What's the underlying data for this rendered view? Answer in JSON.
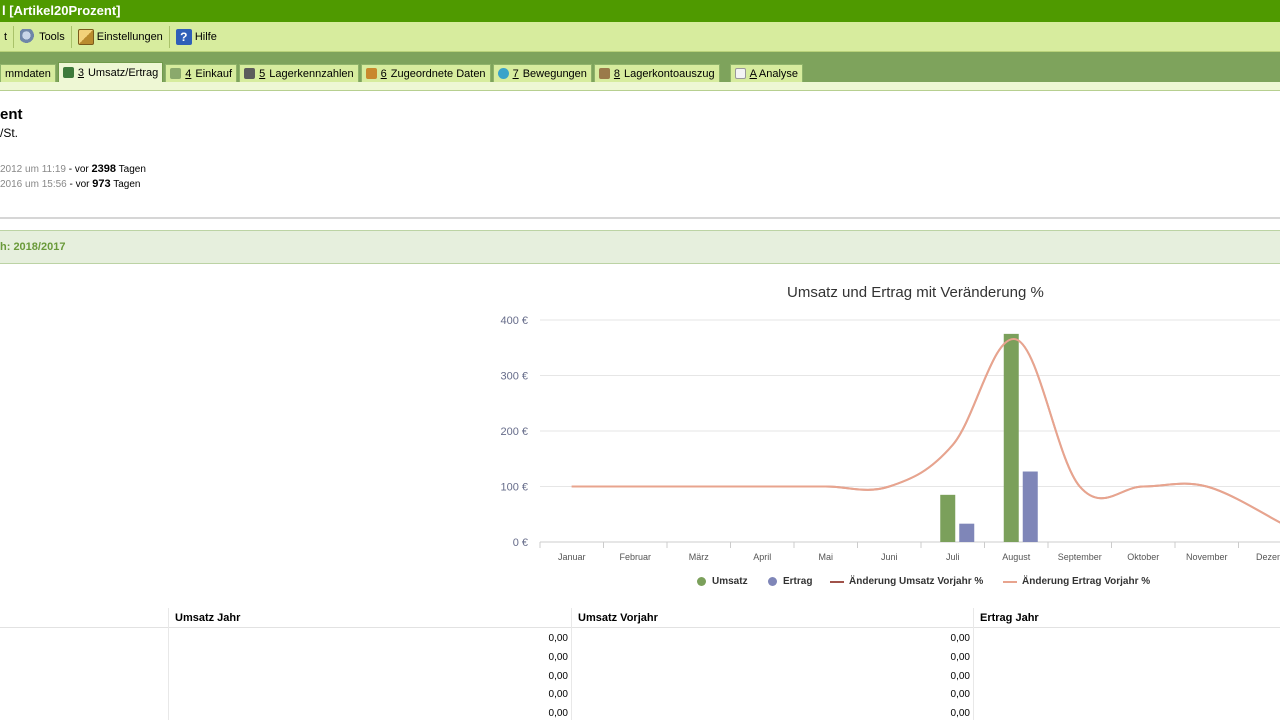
{
  "window": {
    "title": "l [Artikel20Prozent]"
  },
  "menu": {
    "items": [
      {
        "label": "t"
      },
      {
        "label": "Tools"
      },
      {
        "label": "Einstellungen"
      },
      {
        "label": "Hilfe"
      }
    ]
  },
  "tabs": [
    {
      "num": "",
      "label": "mmdaten"
    },
    {
      "num": "3",
      "label": "Umsatz/Ertrag"
    },
    {
      "num": "4",
      "label": "Einkauf"
    },
    {
      "num": "5",
      "label": "Lagerkennzahlen"
    },
    {
      "num": "6",
      "label": "Zugeordnete Daten"
    },
    {
      "num": "7",
      "label": "Bewegungen"
    },
    {
      "num": "8",
      "label": "Lagerkontoauszug"
    },
    {
      "num": "A",
      "label": "Analyse"
    }
  ],
  "header": {
    "title": "ent",
    "subtitle": "/St.",
    "dates": [
      {
        "date": "2012 um 11:19",
        "prefix": " - vor ",
        "count": "2398",
        "suffix": " Tagen"
      },
      {
        "date": "2016 um 15:56",
        "prefix": " - vor ",
        "count": "973",
        "suffix": " Tagen"
      }
    ]
  },
  "section": {
    "label": "h: 2018/2017"
  },
  "chart_data": {
    "type": "bar",
    "title": "Umsatz und Ertrag mit Veränderung %",
    "categories": [
      "Januar",
      "Februar",
      "März",
      "April",
      "Mai",
      "Juni",
      "Juli",
      "August",
      "September",
      "Oktober",
      "November",
      "Dezem"
    ],
    "ylim": [
      0,
      400
    ],
    "yticks": [
      "0 €",
      "100 €",
      "200 €",
      "300 €",
      "400 €"
    ],
    "grid": true,
    "legend_position": "bottom",
    "series": [
      {
        "name": "Umsatz",
        "kind": "bar",
        "color": "#7ba05b",
        "values": [
          0,
          0,
          0,
          0,
          0,
          0,
          85,
          375,
          0,
          0,
          0,
          0
        ]
      },
      {
        "name": "Ertrag",
        "kind": "bar",
        "color": "#7f86b8",
        "values": [
          0,
          0,
          0,
          0,
          0,
          0,
          33,
          127,
          0,
          0,
          0,
          0
        ]
      },
      {
        "name": "Änderung Umsatz Vorjahr %",
        "kind": "line",
        "color": "#a0524a",
        "values": [
          100,
          100,
          100,
          100,
          100,
          100,
          175,
          365,
          100,
          100,
          100,
          35
        ]
      },
      {
        "name": "Änderung Ertrag Vorjahr %",
        "kind": "line",
        "color": "#e8a48e",
        "values": [
          100,
          100,
          100,
          100,
          100,
          100,
          175,
          365,
          100,
          100,
          100,
          35
        ]
      }
    ]
  },
  "table": {
    "headers": [
      "Umsatz Jahr",
      "Umsatz Vorjahr",
      "Ertrag Jahr"
    ],
    "col1": [
      "0,00",
      "0,00",
      "0,00",
      "0,00",
      "0,00"
    ],
    "col2": [
      "0,00",
      "0,00",
      "0,00",
      "0,00",
      "0,00"
    ]
  },
  "colors": {
    "titlebar": "#4f9a00",
    "menubar": "#d7ec9e",
    "tabbar": "#7ea35c",
    "section": "#6a9a3a"
  }
}
